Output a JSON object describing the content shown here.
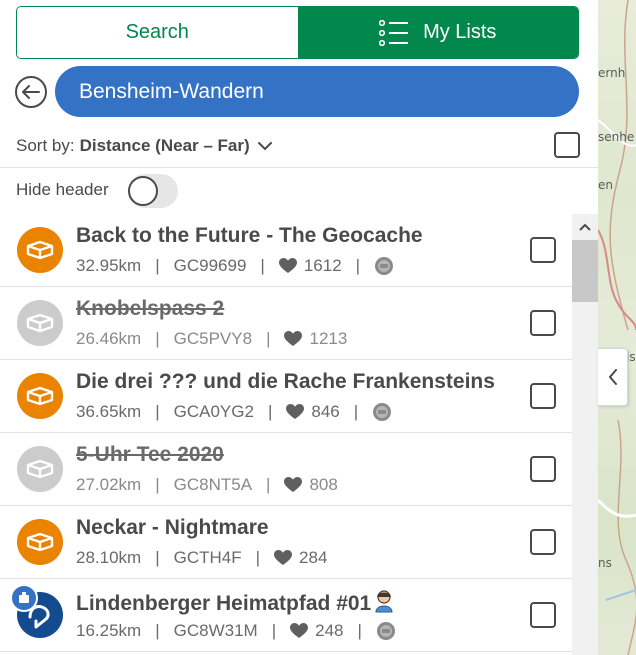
{
  "tabs": {
    "search_label": "Search",
    "lists_label": "My Lists"
  },
  "list": {
    "name": "Bensheim-Wandern"
  },
  "sort": {
    "prefix": "Sort by:",
    "value": "Distance (Near – Far)"
  },
  "hide_header": {
    "label": "Hide header",
    "enabled": false
  },
  "map": {
    "labels": [
      "ernh",
      "senhe",
      "en",
      "is",
      "ns"
    ]
  },
  "colors": {
    "brand_green": "#02874d",
    "list_blue": "#3372c4",
    "traditional_orange": "#e98300",
    "disabled_grey": "#cccccc",
    "wherigo_blue": "#144b8f"
  },
  "caches": [
    {
      "title": "Back to the Future - The Geocache",
      "distance": "32.95km",
      "code": "GC99699",
      "favorites": "1612",
      "disabled": false,
      "type": "traditional",
      "has_award": true
    },
    {
      "title": "Knobelspass 2",
      "distance": "26.46km",
      "code": "GC5PVY8",
      "favorites": "1213",
      "disabled": true,
      "type": "traditional",
      "has_award": false
    },
    {
      "title": "Die drei ??? und die Rache Frankensteins",
      "distance": "36.65km",
      "code": "GCA0YG2",
      "favorites": "846",
      "disabled": false,
      "type": "traditional",
      "has_award": true
    },
    {
      "title": "5-Uhr Tee 2020",
      "distance": "27.02km",
      "code": "GC8NT5A",
      "favorites": "808",
      "disabled": true,
      "type": "traditional",
      "has_award": false
    },
    {
      "title": "Neckar - Nightmare",
      "distance": "28.10km",
      "code": "GCTH4F",
      "favorites": "284",
      "disabled": false,
      "type": "traditional",
      "has_award": false
    },
    {
      "title": "Lindenberger Heimatpfad #01",
      "distance": "16.25km",
      "code": "GC8W31M",
      "favorites": "248",
      "disabled": false,
      "type": "wherigo",
      "has_award": true
    }
  ]
}
